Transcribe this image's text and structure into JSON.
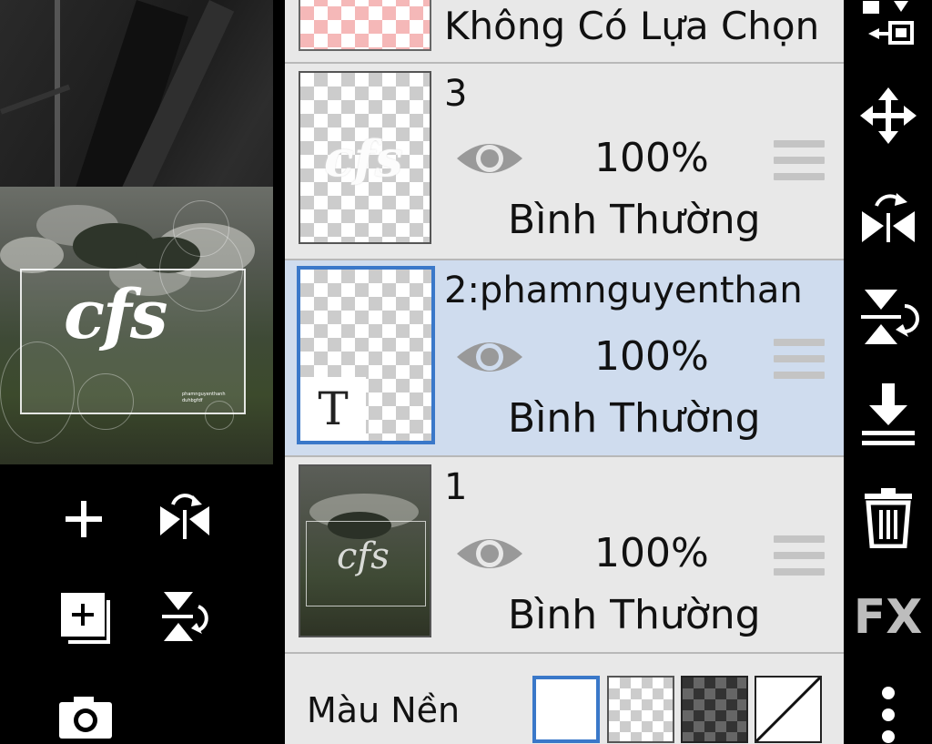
{
  "canvas": {
    "logo_text": "cfs",
    "small_text_line1": "phamnguyenthanh",
    "small_text_line2": "duhbgfdf"
  },
  "layers": [
    {
      "name": "Không Có Lựa Chọn",
      "selected": false
    },
    {
      "name": "3",
      "opacity": "100%",
      "blend": "Bình Thường",
      "selected": false
    },
    {
      "name": "2:phamnguyenthan",
      "opacity": "100%",
      "blend": "Bình Thường",
      "selected": true,
      "text_badge": "T"
    },
    {
      "name": "1",
      "opacity": "100%",
      "blend": "Bình Thường",
      "selected": false
    }
  ],
  "background": {
    "label": "Màu Nền",
    "options": [
      "white",
      "transparent-light",
      "transparent-dark",
      "none"
    ],
    "selected_index": 0
  },
  "right_toolbar": {
    "fx_label": "FX",
    "icons": [
      "layer-transfer-icon",
      "move-icon",
      "flip-horizontal-icon",
      "flip-vertical-icon",
      "merge-down-icon",
      "trash-icon",
      "fx-icon",
      "more-icon"
    ]
  },
  "left_toolbar": {
    "icons": [
      "add-layer-icon",
      "flip-horizontal-icon",
      "duplicate-layer-icon",
      "flip-vertical-icon",
      "camera-icon"
    ]
  },
  "colors": {
    "panel_bg": "#e8e8e8",
    "selected_bg": "#cfdcee",
    "selected_border": "#3a78c9",
    "toolbar_bg": "#000000"
  }
}
